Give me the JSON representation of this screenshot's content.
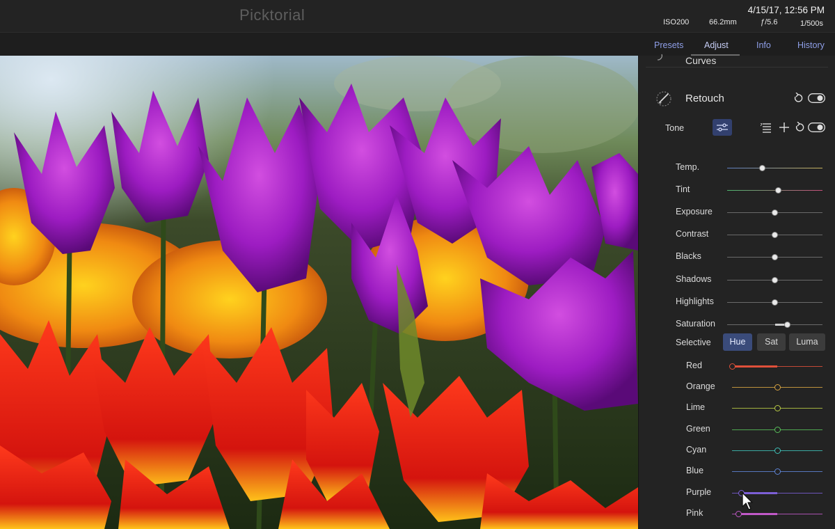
{
  "app": {
    "title": "Picktorial"
  },
  "header": {
    "datetime": "4/15/17, 12:56 PM",
    "iso": "ISO200",
    "focal_length": "66.2mm",
    "aperture": "ƒ/5.6",
    "shutter": "1/500s"
  },
  "tabs": [
    {
      "label": "Presets",
      "active": false
    },
    {
      "label": "Adjust",
      "active": true
    },
    {
      "label": "Info",
      "active": false
    },
    {
      "label": "History",
      "active": false
    }
  ],
  "panel": {
    "curves_label": "Curves",
    "retouch_label": "Retouch",
    "tone_label": "Tone",
    "sliders": [
      {
        "label": "Temp.",
        "value": 0.37
      },
      {
        "label": "Tint",
        "value": 0.54
      },
      {
        "label": "Exposure",
        "value": 0.5
      },
      {
        "label": "Contrast",
        "value": 0.5
      },
      {
        "label": "Blacks",
        "value": 0.5
      },
      {
        "label": "Shadows",
        "value": 0.5
      },
      {
        "label": "Highlights",
        "value": 0.5
      },
      {
        "label": "Saturation",
        "value": 0.63
      }
    ],
    "selective": {
      "label": "Selective",
      "modes": [
        "Hue",
        "Sat",
        "Luma"
      ],
      "active_mode": "Hue",
      "colors": [
        {
          "label": "Red",
          "value": 0.0,
          "color": "#e0503a"
        },
        {
          "label": "Orange",
          "value": 0.5,
          "color": "#d9a441"
        },
        {
          "label": "Lime",
          "value": 0.5,
          "color": "#b9cc45"
        },
        {
          "label": "Green",
          "value": 0.5,
          "color": "#58c15a"
        },
        {
          "label": "Cyan",
          "value": 0.5,
          "color": "#3fc1b8"
        },
        {
          "label": "Blue",
          "value": 0.5,
          "color": "#5f86d8"
        },
        {
          "label": "Purple",
          "value": 0.1,
          "color": "#7d5fd6"
        },
        {
          "label": "Pink",
          "value": 0.07,
          "color": "#c159c8"
        }
      ]
    }
  },
  "colors": {
    "accent": "#8f9fe8",
    "active_button": "#3a4b7a",
    "panel_bg": "#232323"
  }
}
